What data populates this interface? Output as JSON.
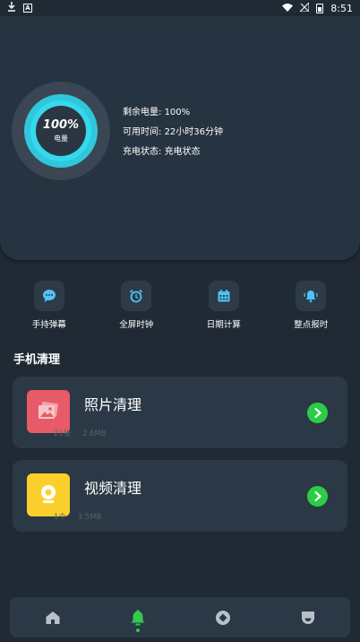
{
  "status_bar": {
    "time": "8:51",
    "left_icons": [
      "download-icon",
      "a-notification-icon"
    ],
    "right_icons": [
      "wifi-icon",
      "no-signal-icon",
      "battery-icon"
    ]
  },
  "battery": {
    "percent": "100%",
    "gauge_label": "电量",
    "level": 1.0,
    "rows": [
      {
        "label": "剩余电量:",
        "value": "100%"
      },
      {
        "label": "可用时间:",
        "value": "22小时36分钟"
      },
      {
        "label": "充电状态:",
        "value": "充电状态"
      }
    ]
  },
  "tools": [
    {
      "label": "手持弹幕",
      "icon": "chat-bubble-icon"
    },
    {
      "label": "全屏时钟",
      "icon": "alarm-clock-icon"
    },
    {
      "label": "日期计算",
      "icon": "calendar-icon"
    },
    {
      "label": "整点报时",
      "icon": "bell-ring-icon"
    }
  ],
  "section_title": "手机清理",
  "cards": {
    "photo": {
      "title": "照片清理",
      "count": "21张",
      "size": "2.6MB",
      "icon": "photo-icon"
    },
    "video": {
      "title": "视频清理",
      "count": "1个",
      "size": "3.5MB",
      "icon": "video-icon"
    }
  },
  "bottom_nav": [
    {
      "icon": "home-icon",
      "active": false
    },
    {
      "icon": "bell-icon",
      "active": true
    },
    {
      "icon": "compass-icon",
      "active": false
    },
    {
      "icon": "profile-icon",
      "active": false
    }
  ],
  "colors": {
    "background": "#1f2a35",
    "card": "#2b3845",
    "accent_cyan": "#35d8ec",
    "accent_green": "#2ccd44",
    "photo_red": "#e85a67",
    "video_yellow": "#fcd02c",
    "tool_icon": "#4fc3f7"
  }
}
